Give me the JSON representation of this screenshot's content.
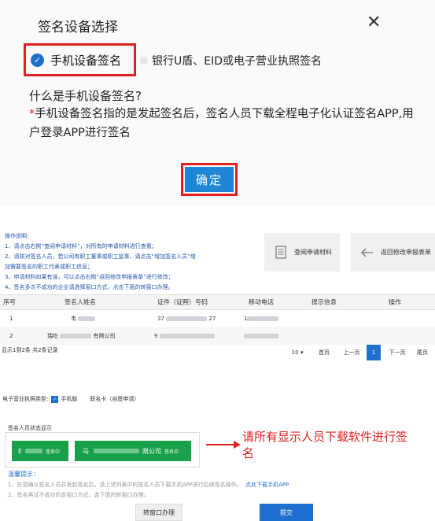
{
  "dialog": {
    "title": "签名设备选择",
    "close_glyph": "✕",
    "mobile_option": "手机设备签名",
    "alt_option": "银行U盾、EID或电子营业执照签名",
    "question": "什么是手机设备签名?",
    "desc_star": "*",
    "desc": "手机设备签名指的是发起签名后，签名人员下载全程电子化认证签名APP,用户登录APP进行签名",
    "confirm": "确定"
  },
  "instructions": {
    "heading": "操作说明：",
    "lines": [
      "1、请点击右侧“查阅申请材料”，对所有的申请材料进行查看；",
      "2、请核对签名人员，若公司有职工董事或职工监事，请点击“增加签名人员”增",
      "加需要签名的职工代表或职工信息；",
      "3、申请材料如果有误，可以点击右侧“返回修改申报表单”进行修改；",
      "4、签名多次不成功的企业请选择窗口方式，点击下面的转窗口办理。"
    ]
  },
  "actions": {
    "query": "查阅申请材料",
    "back": "返回修改申报表单"
  },
  "table": {
    "headers": [
      "序号",
      "签名人姓名",
      "证件（证照）号码",
      "移动电话",
      "提示信息",
      "操作"
    ],
    "rows": [
      {
        "index": "1",
        "name": "韦",
        "id": "37",
        "id_tail": "27",
        "phone": "1"
      },
      {
        "index": "2",
        "name": "瑞吃",
        "company": "有限公司",
        "id": "9",
        "phone": ""
      }
    ]
  },
  "summary": "显示1到2条 共2条记录",
  "pager": {
    "size": "10",
    "size_caret": "▾",
    "first": "首页",
    "prev": "上一页",
    "current": "1",
    "next": "下一页",
    "last": "尾页"
  },
  "license": {
    "label": "电子营业执照类型:",
    "mobile": "手机版",
    "card": "联名卡（自愿申请）"
  },
  "status": {
    "title": "签名人员状态显示",
    "signers": [
      {
        "name": "E",
        "badge": "签名中"
      },
      {
        "name": "马",
        "company": "限公司",
        "badge": "签名中"
      }
    ]
  },
  "annotation": "请所有显示人员下载软件进行签名",
  "tips": {
    "title": "温馨提示：",
    "line1": "1、在您确认签名人员并发起签名后，请上述列表中的签名人员下载手机APP进行后续签名操作。",
    "link": "点此下载手机APP",
    "line2": "2、签名再试不成功的走窗口方式，选下面的转窗口办理。"
  },
  "buttons": {
    "switch": "转窗口办理",
    "submit": "提交"
  },
  "colors": {
    "accent": "#1f6fcf",
    "highlight": "#e02020",
    "signing": "#19a04b"
  }
}
